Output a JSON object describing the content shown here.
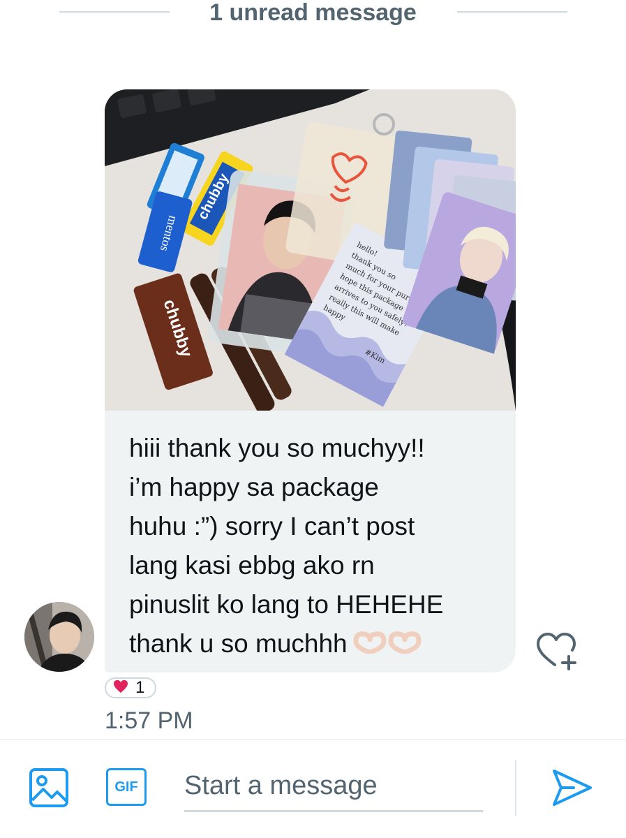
{
  "unread_divider": {
    "label": "1 unread message"
  },
  "message": {
    "text_lines": [
      "hiii thank you so muchyy!!",
      "i’m happy sa package",
      "huhu :”) sorry I can’t post",
      "lang kasi ebbg ako rn",
      "pinuslit ko lang to HEHEHE",
      "thank u so muchhh"
    ],
    "emoji": "🫶🫶",
    "photo_note_lines": [
      "hello!",
      "thank you so",
      "much for your purchase.",
      "hope this package",
      "arrives to you safely!",
      "really this will make",
      "happy",
      "#Kim"
    ],
    "candy_labels": [
      "mentos",
      "chubby",
      "chubby"
    ],
    "reaction": {
      "icon": "heart-icon",
      "count": "1"
    },
    "timestamp": "1:57 PM"
  },
  "composer": {
    "placeholder": "Start a message",
    "gif_label": "GIF"
  },
  "colors": {
    "accent": "#1d9bf0",
    "bubble": "#eff3f4",
    "heart": "#f91880",
    "secondary_text": "#536471"
  }
}
